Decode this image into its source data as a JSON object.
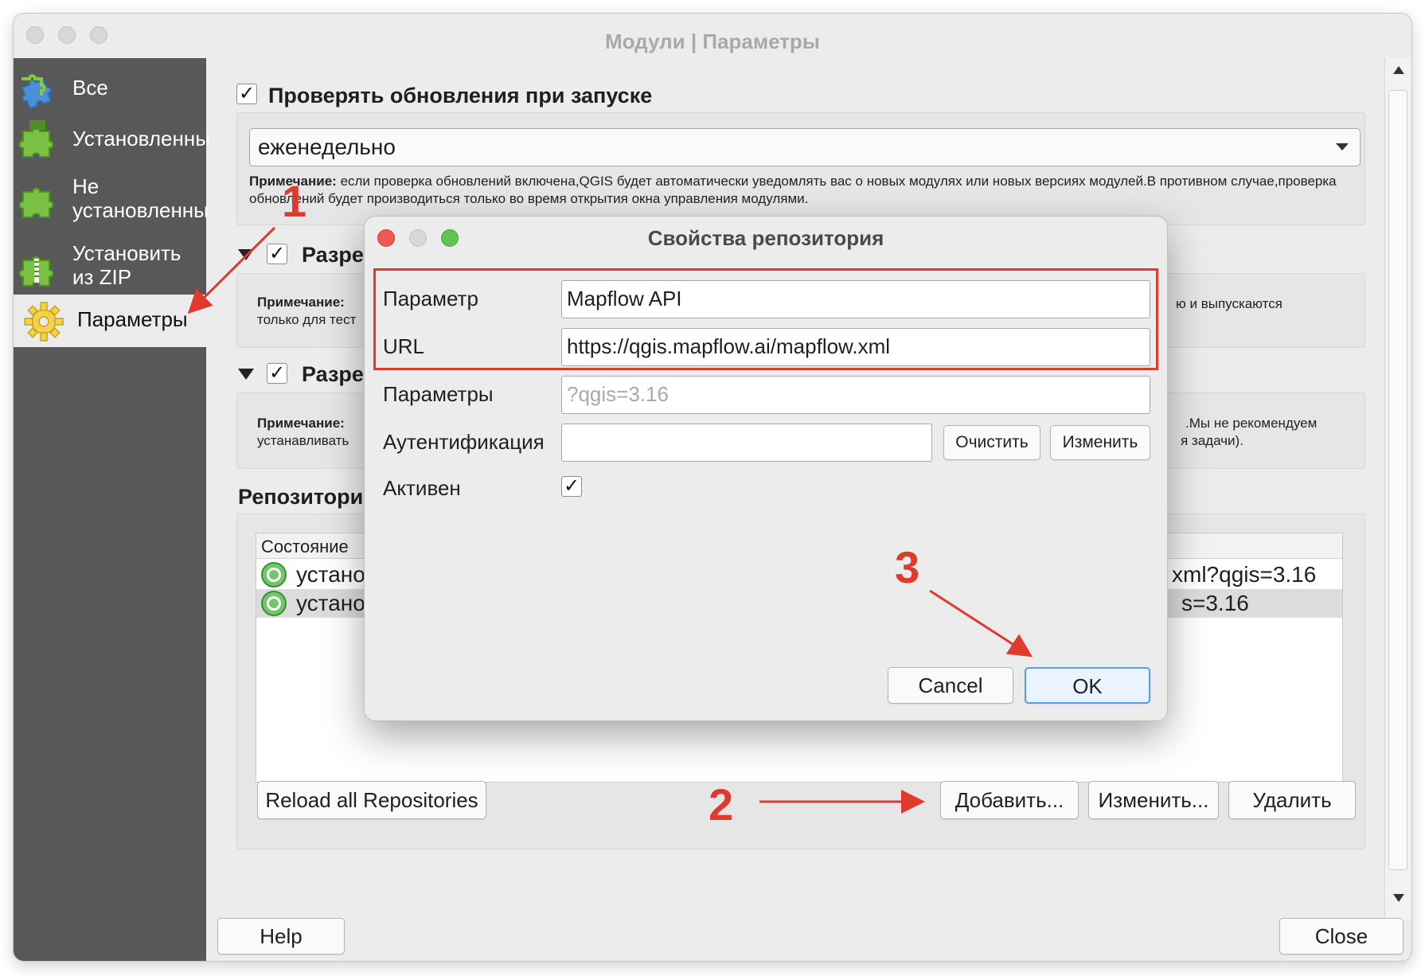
{
  "window": {
    "title": "Модули | Параметры"
  },
  "sidebar": {
    "items": [
      {
        "label": "Все",
        "icon": "puzzle-blue-icon"
      },
      {
        "label": "Установленны",
        "icon": "puzzle-green-icon"
      },
      {
        "label": "Не установленны",
        "icon": "puzzle-green-icon"
      },
      {
        "label": "Установить из ZIP",
        "icon": "puzzle-zip-icon"
      },
      {
        "label": "Параметры",
        "icon": "gear-icon"
      }
    ]
  },
  "settings": {
    "check_updates_label": "Проверять обновления при запуске",
    "frequency_value": "еженедельно",
    "note_bold": "Примечание:",
    "note_text": "если проверка обновлений включена,QGIS будет автоматически уведомлять вас о новых модулях или новых версиях модулей.В противном случае,проверка обновлений будет производиться только во время открытия окна управления модулями.",
    "section2_label": "Разре",
    "section2_note_bold": "Примечание:",
    "section2_note_left": "только для тест",
    "section2_note_right": "ю и выпускаются",
    "section3_label": "Разре",
    "section3_note_bold": "Примечание:",
    "section3_note_left": "устанавливать",
    "section3_note_right1": ".Мы не рекомендуем",
    "section3_note_right2": "я задачи).",
    "repos_heading": "Репозитори",
    "table_header": "Состояние",
    "rows": [
      {
        "status": "устано",
        "tail": "xml?qgis=3.16"
      },
      {
        "status": "устано",
        "tail": "s=3.16"
      }
    ],
    "reload_button": "Reload all Repositories",
    "add_button": "Добавить...",
    "edit_button": "Изменить...",
    "delete_button": "Удалить",
    "help_button": "Help",
    "close_button": "Close"
  },
  "dialog": {
    "title": "Свойства репозитория",
    "name_label": "Параметр",
    "name_value": "Mapflow API",
    "url_label": "URL",
    "url_value": "https://qgis.mapflow.ai/mapflow.xml",
    "params_label": "Параметры",
    "params_placeholder": "?qgis=3.16",
    "auth_label": "Аутентификация",
    "auth_value": "",
    "clear_button": "Очистить",
    "change_button": "Изменить",
    "active_label": "Активен",
    "cancel_button": "Cancel",
    "ok_button": "OK"
  },
  "annotations": {
    "step1": "1",
    "step2": "2",
    "step3": "3",
    "color": "#e03a2f"
  }
}
